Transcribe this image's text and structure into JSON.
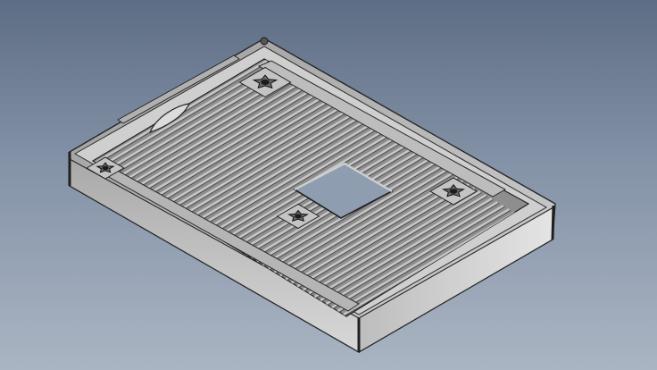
{
  "viewport": {
    "background_top": "#5d6d84",
    "background_bottom": "#aab5c3"
  },
  "model": {
    "body_fill": "#b9b9b9",
    "rim_fill": "#c9c9c9",
    "floor_fill": "#8e8e8e",
    "rib_light": "#c6c6c6",
    "rib_dark": "#4f4f4f",
    "edge_color": "#262626",
    "cutout_color": "#8f9db1",
    "features": [
      "tray-body",
      "rim-wall",
      "rib-floor",
      "center-cutout",
      "corner-standoffs",
      "side-slot"
    ]
  }
}
